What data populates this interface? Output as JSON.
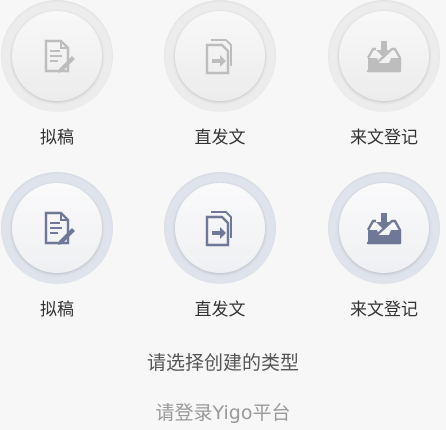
{
  "rows": [
    {
      "state": "inactive",
      "accent": "#bdbdbd",
      "items": [
        {
          "label": "拟稿",
          "icon": "draft-edit-icon"
        },
        {
          "label": "直发文",
          "icon": "send-document-icon"
        },
        {
          "label": "来文登记",
          "icon": "inbox-receive-icon"
        }
      ]
    },
    {
      "state": "active",
      "accent": "#6f7896",
      "items": [
        {
          "label": "拟稿",
          "icon": "draft-edit-icon"
        },
        {
          "label": "直发文",
          "icon": "send-document-icon"
        },
        {
          "label": "来文登记",
          "icon": "inbox-receive-icon"
        }
      ]
    }
  ],
  "prompt": "请选择创建的类型",
  "footer": "请登录Yigo平台"
}
